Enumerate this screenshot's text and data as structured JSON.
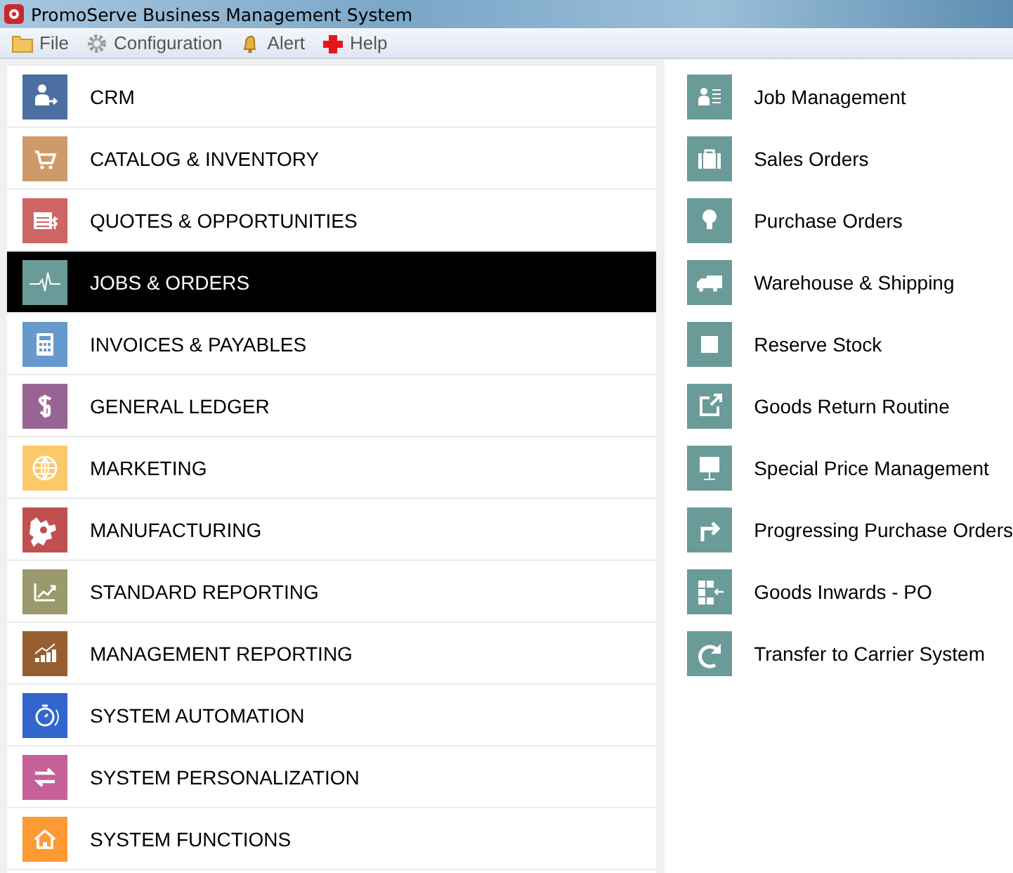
{
  "window": {
    "title": "PromoServe Business Management System"
  },
  "menu": [
    {
      "label": "File"
    },
    {
      "label": "Configuration"
    },
    {
      "label": "Alert"
    },
    {
      "label": "Help"
    }
  ],
  "modules": [
    {
      "label": "CRM",
      "color": "#4a6fa0",
      "selected": false
    },
    {
      "label": "CATALOG & INVENTORY",
      "color": "#cf9a6a",
      "selected": false
    },
    {
      "label": "QUOTES & OPPORTUNITIES",
      "color": "#cf6565",
      "selected": false
    },
    {
      "label": "JOBS & ORDERS",
      "color": "#6a9b98",
      "selected": true
    },
    {
      "label": "INVOICES & PAYABLES",
      "color": "#6699cc",
      "selected": false
    },
    {
      "label": "GENERAL LEDGER",
      "color": "#986494",
      "selected": false
    },
    {
      "label": "MARKETING",
      "color": "#fcc96a",
      "selected": false
    },
    {
      "label": "MANUFACTURING",
      "color": "#c05050",
      "selected": false
    },
    {
      "label": "STANDARD REPORTING",
      "color": "#9a9a6c",
      "selected": false
    },
    {
      "label": "MANAGEMENT REPORTING",
      "color": "#965f30",
      "selected": false
    },
    {
      "label": "SYSTEM AUTOMATION",
      "color": "#3366cc",
      "selected": false
    },
    {
      "label": "SYSTEM PERSONALIZATION",
      "color": "#c66098",
      "selected": false
    },
    {
      "label": "SYSTEM FUNCTIONS",
      "color": "#fe9a33",
      "selected": false
    }
  ],
  "actions": [
    {
      "label": "Job Management"
    },
    {
      "label": "Sales Orders"
    },
    {
      "label": "Purchase Orders"
    },
    {
      "label": "Warehouse & Shipping"
    },
    {
      "label": "Reserve Stock"
    },
    {
      "label": "Goods Return Routine"
    },
    {
      "label": "Special Price Management"
    },
    {
      "label": "Progressing Purchase Orders"
    },
    {
      "label": "Goods Inwards - PO"
    },
    {
      "label": "Transfer to Carrier System"
    }
  ]
}
